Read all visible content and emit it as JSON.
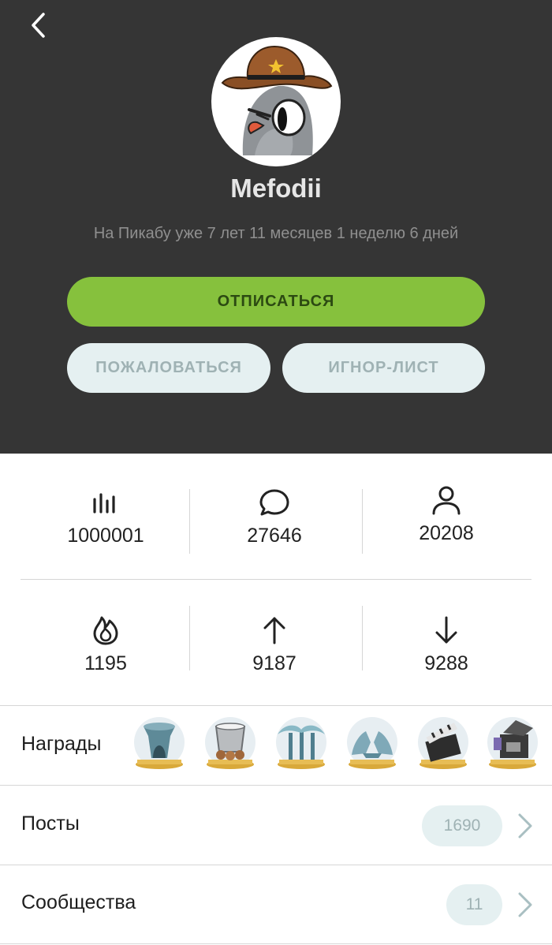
{
  "profile": {
    "username": "Mefodii",
    "since": "На Пикабу уже 7 лет 11 месяцев 1 неделю 6 дней"
  },
  "actions": {
    "unsubscribe": "ОТПИСАТЬСЯ",
    "report": "ПОЖАЛОВАТЬСЯ",
    "ignore_list": "ИГНОР-ЛИСТ"
  },
  "stats": {
    "rating": {
      "icon": "bar-chart-icon",
      "value": "1000001"
    },
    "comments": {
      "icon": "comment-icon",
      "value": "27646"
    },
    "subscribers": {
      "icon": "user-icon",
      "value": "20208"
    },
    "hot": {
      "icon": "fire-icon",
      "value": "1195"
    },
    "pluses": {
      "icon": "arrow-up-icon",
      "value": "9187"
    },
    "minuses": {
      "icon": "arrow-down-icon",
      "value": "9288"
    }
  },
  "awards": {
    "label": "Награды",
    "items": [
      "fountain-award-icon",
      "bucket-award-icon",
      "palm-award-icon",
      "crystal-award-icon",
      "clapperboard-award-icon",
      "camera-award-icon"
    ]
  },
  "posts": {
    "label": "Посты",
    "count": "1690"
  },
  "communities": {
    "label": "Сообщества",
    "count": "11"
  },
  "colors": {
    "header_bg": "#353535",
    "accent_green": "#86c13d",
    "pill_bg": "#e5f0f1"
  }
}
